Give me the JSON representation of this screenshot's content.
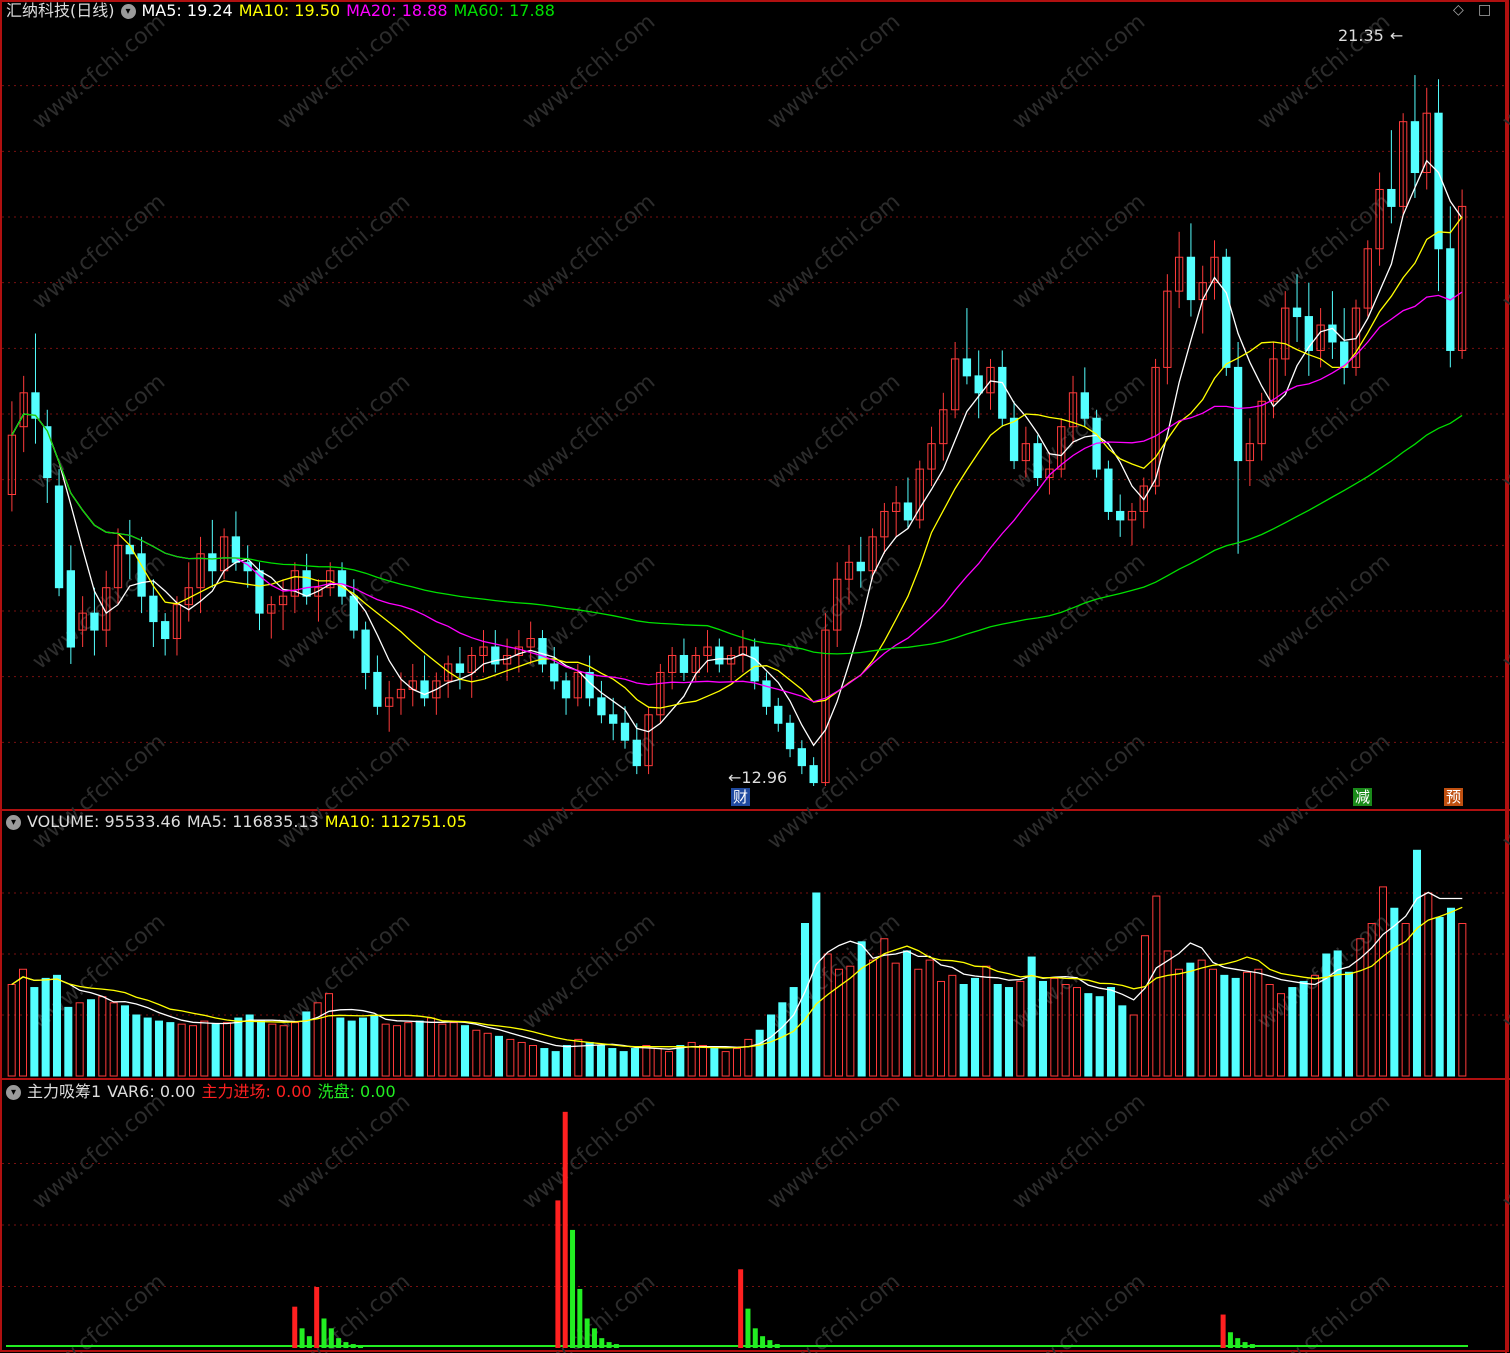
{
  "main_header": {
    "stock_label": "汇纳科技(日线)",
    "ma5": "MA5: 19.24",
    "ma10": "MA10: 19.50",
    "ma20": "MA20: 18.88",
    "ma60": "MA60: 17.88"
  },
  "volume_header": {
    "volume": "VOLUME: 95533.46",
    "ma5": "MA5: 116835.13",
    "ma10": "MA10: 112751.05"
  },
  "indicator_header": {
    "name": "主力吸筹1",
    "var6": "VAR6: 0.00",
    "inflow": "主力进场: 0.00",
    "washout": "洗盘: 0.00"
  },
  "annotations": {
    "high": "21.35",
    "low": "12.96",
    "tag_fin": "财",
    "tag_reduce": "减",
    "tag_pre": "预"
  },
  "watermark": "www.cfchi.com",
  "colors": {
    "up": "#ff3b3b",
    "down": "#54ffff",
    "ma5": "#ffffff",
    "ma10": "#ffff00",
    "ma20": "#ff00ff",
    "ma60": "#00e000",
    "grid": "#7a1010",
    "frame": "#b01010",
    "ind_red": "#ff2020",
    "ind_green": "#22ee22"
  },
  "chart_data": [
    {
      "type": "candlestick",
      "title": "汇纳科技(日线)",
      "high_marker": 21.35,
      "low_marker": 12.96,
      "ylim": [
        12.7,
        22.0
      ],
      "series_ohlc": [
        [
          16.4,
          17.5,
          16.2,
          17.1
        ],
        [
          17.2,
          17.8,
          16.9,
          17.6
        ],
        [
          17.6,
          18.3,
          17.0,
          17.3
        ],
        [
          17.2,
          17.4,
          16.3,
          16.6
        ],
        [
          16.5,
          16.7,
          15.2,
          15.3
        ],
        [
          15.5,
          15.8,
          14.4,
          14.6
        ],
        [
          14.8,
          15.2,
          14.6,
          15.0
        ],
        [
          15.0,
          15.3,
          14.5,
          14.8
        ],
        [
          14.8,
          15.5,
          14.6,
          15.3
        ],
        [
          15.3,
          16.0,
          15.1,
          15.8
        ],
        [
          15.8,
          16.1,
          15.4,
          15.7
        ],
        [
          15.7,
          15.9,
          15.0,
          15.2
        ],
        [
          15.2,
          15.4,
          14.6,
          14.9
        ],
        [
          14.9,
          15.0,
          14.5,
          14.7
        ],
        [
          14.7,
          15.2,
          14.5,
          15.1
        ],
        [
          15.1,
          15.6,
          14.9,
          15.3
        ],
        [
          15.3,
          15.9,
          15.0,
          15.7
        ],
        [
          15.7,
          16.1,
          15.3,
          15.5
        ],
        [
          15.5,
          16.0,
          15.4,
          15.9
        ],
        [
          15.9,
          16.2,
          15.5,
          15.6
        ],
        [
          15.6,
          15.8,
          15.3,
          15.5
        ],
        [
          15.5,
          15.6,
          14.8,
          15.0
        ],
        [
          15.0,
          15.2,
          14.7,
          15.1
        ],
        [
          15.1,
          15.4,
          14.8,
          15.2
        ],
        [
          15.2,
          15.6,
          15.0,
          15.5
        ],
        [
          15.5,
          15.7,
          15.1,
          15.2
        ],
        [
          15.2,
          15.4,
          14.9,
          15.3
        ],
        [
          15.3,
          15.6,
          15.2,
          15.5
        ],
        [
          15.5,
          15.6,
          15.1,
          15.2
        ],
        [
          15.2,
          15.4,
          14.7,
          14.8
        ],
        [
          14.8,
          14.9,
          14.1,
          14.3
        ],
        [
          14.3,
          14.5,
          13.8,
          13.9
        ],
        [
          13.9,
          14.2,
          13.6,
          14.0
        ],
        [
          14.0,
          14.3,
          13.8,
          14.1
        ],
        [
          14.1,
          14.4,
          13.9,
          14.2
        ],
        [
          14.2,
          14.5,
          13.9,
          14.0
        ],
        [
          14.0,
          14.3,
          13.8,
          14.2
        ],
        [
          14.2,
          14.5,
          14.0,
          14.4
        ],
        [
          14.4,
          14.6,
          14.1,
          14.3
        ],
        [
          14.3,
          14.6,
          14.0,
          14.5
        ],
        [
          14.5,
          14.8,
          14.3,
          14.6
        ],
        [
          14.6,
          14.8,
          14.3,
          14.4
        ],
        [
          14.4,
          14.7,
          14.2,
          14.5
        ],
        [
          14.5,
          14.8,
          14.3,
          14.6
        ],
        [
          14.6,
          14.9,
          14.4,
          14.7
        ],
        [
          14.7,
          14.8,
          14.3,
          14.4
        ],
        [
          14.4,
          14.6,
          14.1,
          14.2
        ],
        [
          14.2,
          14.3,
          13.8,
          14.0
        ],
        [
          14.0,
          14.4,
          13.9,
          14.3
        ],
        [
          14.3,
          14.5,
          13.9,
          14.0
        ],
        [
          14.0,
          14.2,
          13.7,
          13.8
        ],
        [
          13.8,
          14.0,
          13.5,
          13.7
        ],
        [
          13.7,
          13.9,
          13.4,
          13.5
        ],
        [
          13.5,
          13.7,
          13.1,
          13.2
        ],
        [
          13.2,
          13.9,
          13.1,
          13.8
        ],
        [
          13.8,
          14.4,
          13.7,
          14.3
        ],
        [
          14.3,
          14.6,
          14.1,
          14.5
        ],
        [
          14.5,
          14.7,
          14.2,
          14.3
        ],
        [
          14.3,
          14.6,
          14.2,
          14.5
        ],
        [
          14.5,
          14.8,
          14.3,
          14.6
        ],
        [
          14.6,
          14.7,
          14.3,
          14.4
        ],
        [
          14.4,
          14.6,
          14.2,
          14.5
        ],
        [
          14.5,
          14.8,
          14.3,
          14.6
        ],
        [
          14.6,
          14.7,
          14.1,
          14.2
        ],
        [
          14.2,
          14.3,
          13.8,
          13.9
        ],
        [
          13.9,
          14.0,
          13.6,
          13.7
        ],
        [
          13.7,
          13.8,
          13.3,
          13.4
        ],
        [
          13.4,
          13.5,
          13.1,
          13.2
        ],
        [
          13.2,
          13.3,
          12.96,
          13.0
        ],
        [
          13.0,
          15.0,
          12.96,
          14.8
        ],
        [
          14.8,
          15.6,
          14.6,
          15.4
        ],
        [
          15.4,
          15.8,
          15.1,
          15.6
        ],
        [
          15.6,
          15.9,
          15.3,
          15.5
        ],
        [
          15.5,
          16.0,
          15.4,
          15.9
        ],
        [
          15.9,
          16.3,
          15.7,
          16.2
        ],
        [
          16.2,
          16.5,
          15.9,
          16.3
        ],
        [
          16.3,
          16.6,
          16.0,
          16.1
        ],
        [
          16.1,
          16.8,
          16.0,
          16.7
        ],
        [
          16.7,
          17.2,
          16.5,
          17.0
        ],
        [
          17.0,
          17.6,
          16.8,
          17.4
        ],
        [
          17.4,
          18.2,
          17.3,
          18.0
        ],
        [
          18.0,
          18.6,
          17.7,
          17.8
        ],
        [
          17.8,
          18.1,
          17.3,
          17.6
        ],
        [
          17.6,
          18.0,
          17.4,
          17.9
        ],
        [
          17.9,
          18.1,
          17.2,
          17.3
        ],
        [
          17.3,
          17.5,
          16.7,
          16.8
        ],
        [
          16.8,
          17.2,
          16.6,
          17.0
        ],
        [
          17.0,
          17.1,
          16.5,
          16.6
        ],
        [
          16.6,
          16.9,
          16.4,
          16.7
        ],
        [
          16.7,
          17.3,
          16.6,
          17.2
        ],
        [
          17.2,
          17.8,
          17.0,
          17.6
        ],
        [
          17.6,
          17.9,
          17.2,
          17.3
        ],
        [
          17.3,
          17.4,
          16.6,
          16.7
        ],
        [
          16.7,
          16.8,
          16.1,
          16.2
        ],
        [
          16.2,
          16.4,
          15.9,
          16.1
        ],
        [
          16.1,
          16.3,
          15.8,
          16.2
        ],
        [
          16.2,
          16.6,
          16.0,
          16.5
        ],
        [
          16.5,
          18.0,
          16.4,
          17.9
        ],
        [
          17.9,
          19.0,
          17.7,
          18.8
        ],
        [
          18.8,
          19.5,
          18.6,
          19.2
        ],
        [
          19.2,
          19.6,
          18.5,
          18.7
        ],
        [
          18.7,
          19.1,
          18.3,
          18.9
        ],
        [
          18.9,
          19.4,
          18.7,
          19.2
        ],
        [
          19.2,
          19.3,
          17.8,
          17.9
        ],
        [
          17.9,
          18.2,
          15.7,
          16.8
        ],
        [
          16.8,
          17.3,
          16.5,
          17.0
        ],
        [
          17.0,
          17.6,
          16.8,
          17.5
        ],
        [
          17.5,
          18.2,
          17.3,
          18.0
        ],
        [
          18.0,
          18.8,
          17.8,
          18.6
        ],
        [
          18.6,
          19.0,
          18.2,
          18.5
        ],
        [
          18.5,
          18.9,
          17.8,
          18.1
        ],
        [
          18.1,
          18.6,
          17.9,
          18.4
        ],
        [
          18.4,
          18.8,
          18.0,
          18.2
        ],
        [
          18.2,
          18.6,
          17.7,
          17.9
        ],
        [
          17.9,
          18.7,
          17.8,
          18.6
        ],
        [
          18.6,
          19.4,
          18.5,
          19.3
        ],
        [
          19.3,
          20.2,
          19.1,
          20.0
        ],
        [
          20.0,
          20.7,
          19.6,
          19.8
        ],
        [
          19.8,
          20.9,
          19.7,
          20.8
        ],
        [
          20.8,
          21.35,
          19.9,
          20.2
        ],
        [
          20.2,
          21.2,
          20.0,
          20.9
        ],
        [
          20.9,
          21.3,
          18.8,
          19.3
        ],
        [
          19.3,
          19.8,
          17.9,
          18.1
        ],
        [
          18.1,
          20.0,
          18.0,
          19.8
        ]
      ]
    },
    {
      "type": "bar",
      "title": "VOLUME",
      "values": [
        60,
        70,
        58,
        64,
        66,
        45,
        48,
        50,
        52,
        48,
        46,
        40,
        38,
        36,
        35,
        34,
        33,
        36,
        34,
        35,
        38,
        40,
        36,
        34,
        33,
        35,
        42,
        48,
        54,
        38,
        36,
        38,
        40,
        34,
        33,
        35,
        36,
        38,
        34,
        35,
        33,
        30,
        28,
        26,
        24,
        22,
        20,
        18,
        16,
        20,
        24,
        22,
        20,
        18,
        16,
        18,
        20,
        18,
        16,
        20,
        22,
        20,
        18,
        16,
        18,
        24,
        30,
        40,
        48,
        58,
        100,
        120,
        80,
        70,
        72,
        88,
        76,
        90,
        74,
        82,
        70,
        76,
        62,
        66,
        60,
        64,
        72,
        60,
        58,
        62,
        78,
        62,
        64,
        60,
        58,
        54,
        52,
        58,
        46,
        40,
        92,
        118,
        82,
        70,
        74,
        76,
        70,
        66,
        64,
        68,
        70,
        60,
        54,
        58,
        62,
        66,
        80,
        82,
        68,
        90,
        100,
        124,
        110,
        100,
        148,
        120,
        104,
        110,
        100
      ],
      "ylim": [
        0,
        160
      ]
    },
    {
      "type": "bar",
      "title": "主力吸筹1",
      "series": [
        {
          "name": "主力进场",
          "values": [
            0,
            0,
            0,
            0,
            0,
            0,
            0,
            0,
            0,
            0,
            0,
            0,
            0,
            0,
            0,
            0,
            0,
            0,
            0,
            0,
            0,
            0,
            0,
            0,
            0,
            0,
            0,
            0,
            0,
            0,
            0,
            0,
            0,
            0,
            0,
            0,
            0,
            0,
            0,
            0,
            0,
            0,
            0,
            0,
            0,
            0,
            0,
            0,
            0,
            0,
            0,
            0,
            0,
            0,
            0,
            0,
            0,
            0,
            0,
            0,
            0,
            0,
            0,
            0,
            0,
            0,
            0,
            0,
            0,
            0,
            0,
            0,
            0,
            0,
            0,
            0,
            0,
            0,
            0,
            0,
            0,
            0,
            0,
            0,
            0,
            0,
            0,
            0,
            0,
            0,
            0,
            0,
            0,
            0,
            0,
            0,
            0,
            0,
            0,
            0,
            0,
            0,
            0,
            0,
            0,
            0,
            0,
            0,
            0,
            0,
            0,
            0,
            0,
            0,
            0,
            0,
            0,
            0,
            0,
            0,
            0,
            0,
            0,
            0,
            0,
            0,
            0,
            0,
            0,
            0,
            0,
            0,
            0,
            0,
            0,
            0,
            0,
            0,
            0,
            0,
            0,
            0,
            0,
            0,
            0,
            0,
            0,
            0,
            0,
            0,
            0,
            0,
            0,
            0,
            0,
            0,
            0,
            0,
            0,
            0,
            0,
            0,
            0,
            0,
            0,
            0,
            0,
            0,
            0,
            0,
            0,
            0,
            0,
            0,
            0,
            0,
            0,
            0,
            0,
            0,
            0,
            0,
            0,
            0,
            0,
            0,
            0,
            0,
            0,
            0,
            0,
            0,
            0,
            0,
            0,
            0,
            0,
            0,
            0,
            0,
            0,
            0
          ]
        },
        {
          "name": "洗盘",
          "values": []
        }
      ],
      "spikes_red": [
        [
          39,
          42
        ],
        [
          42,
          62
        ],
        [
          75,
          150
        ],
        [
          76,
          240
        ],
        [
          100,
          80
        ],
        [
          166,
          34
        ]
      ],
      "spikes_green": [
        [
          40,
          20
        ],
        [
          41,
          12
        ],
        [
          43,
          30
        ],
        [
          44,
          20
        ],
        [
          45,
          10
        ],
        [
          46,
          6
        ],
        [
          47,
          4
        ],
        [
          48,
          3
        ],
        [
          77,
          120
        ],
        [
          78,
          60
        ],
        [
          79,
          30
        ],
        [
          80,
          20
        ],
        [
          81,
          10
        ],
        [
          82,
          6
        ],
        [
          83,
          4
        ],
        [
          101,
          40
        ],
        [
          102,
          20
        ],
        [
          103,
          12
        ],
        [
          104,
          8
        ],
        [
          105,
          4
        ],
        [
          167,
          16
        ],
        [
          168,
          10
        ],
        [
          169,
          6
        ],
        [
          170,
          4
        ]
      ],
      "ylim": [
        0,
        250
      ]
    }
  ]
}
